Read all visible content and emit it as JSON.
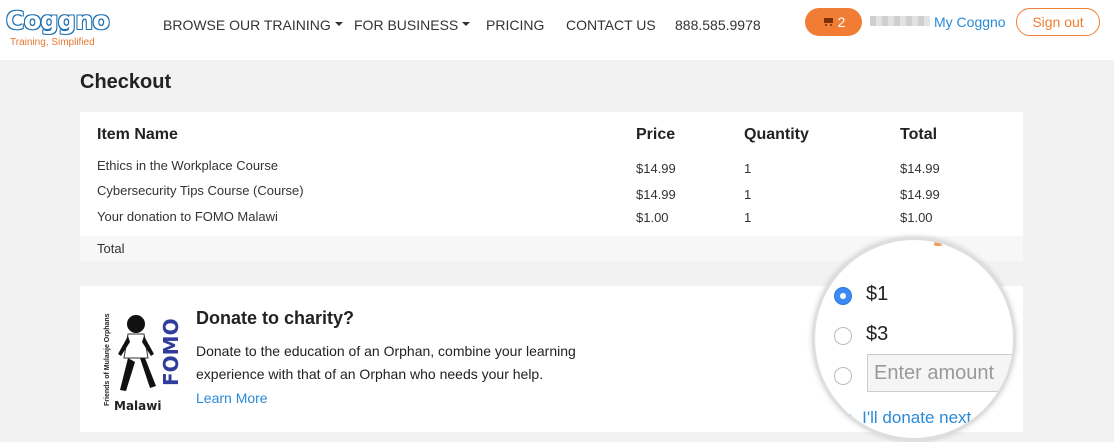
{
  "header": {
    "logo_text": "Coggno",
    "logo_tagline": "Training, Simplified",
    "nav": {
      "browse": "BROWSE OUR TRAINING",
      "business": "FOR BUSINESS",
      "pricing": "PRICING",
      "contact": "CONTACT US",
      "phone": "888.585.9978"
    },
    "cart_count": "2",
    "my_link": "My Coggno",
    "signout": "Sign out"
  },
  "checkout": {
    "title": "Checkout",
    "columns": {
      "item": "Item Name",
      "price": "Price",
      "quantity": "Quantity",
      "total": "Total"
    },
    "rows": [
      {
        "item": "Ethics in the Workplace Course",
        "price": "$14.99",
        "quantity": "1",
        "total": "$14.99"
      },
      {
        "item": "Cybersecurity Tips Course (Course)",
        "price": "$14.99",
        "quantity": "1",
        "total": "$14.99"
      },
      {
        "item": "Your donation to FOMO Malawi",
        "price": "$1.00",
        "quantity": "1",
        "total": "$1.00"
      }
    ],
    "total_label": "Total"
  },
  "donate": {
    "logo_side_text": "Friends of Mulanje Orphans",
    "logo_acronym": "FOMO",
    "logo_country": "Malawi",
    "title": "Donate to charity?",
    "text": "Donate to the education of an Orphan, combine your learning experience with that of an Orphan who needs your help.",
    "learn_more": "Learn More",
    "options": {
      "one": "$1",
      "three": "$3"
    },
    "selected": "$1",
    "amount_placeholder": "Enter amount",
    "skip": "kip, I'll donate next"
  },
  "colors": {
    "accent": "#f07d33",
    "link": "#2a8ad8",
    "brand_blue": "#3aa0e2",
    "fomo_blue": "#2f3c9c"
  }
}
